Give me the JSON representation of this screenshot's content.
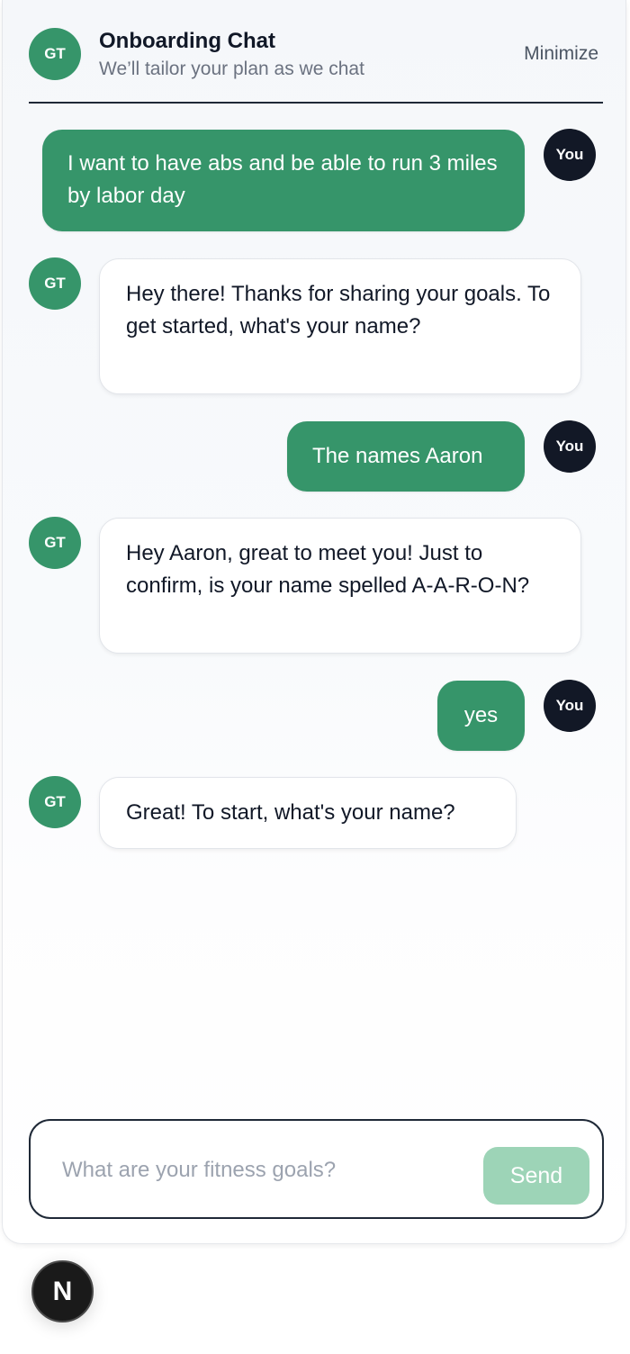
{
  "header": {
    "avatar_initials": "GT",
    "title": "Onboarding Chat",
    "subtitle": "We’ll tailor your plan as we chat",
    "minimize_label": "Minimize"
  },
  "messages": [
    {
      "role": "user",
      "avatar": "You",
      "text": "I want to have abs and be able to run 3 miles by labor day"
    },
    {
      "role": "bot",
      "avatar": "GT",
      "text": "Hey there! Thanks for sharing your goals. To get started, what's your name?"
    },
    {
      "role": "user",
      "avatar": "You",
      "text": "The names Aaron"
    },
    {
      "role": "bot",
      "avatar": "GT",
      "text": "Hey Aaron, great to meet you! Just to confirm, is your name spelled A-A-R-O-N?"
    },
    {
      "role": "user",
      "avatar": "You",
      "text": "yes"
    },
    {
      "role": "bot",
      "avatar": "GT",
      "text": "Great! To start, what's your name?"
    }
  ],
  "composer": {
    "placeholder": "What are your fitness goals?",
    "value": "",
    "send_label": "Send"
  },
  "dev_badge": {
    "letter": "N"
  },
  "colors": {
    "brand_green": "#36956a",
    "send_disabled": "#9dd4b7",
    "user_avatar": "#121826"
  }
}
